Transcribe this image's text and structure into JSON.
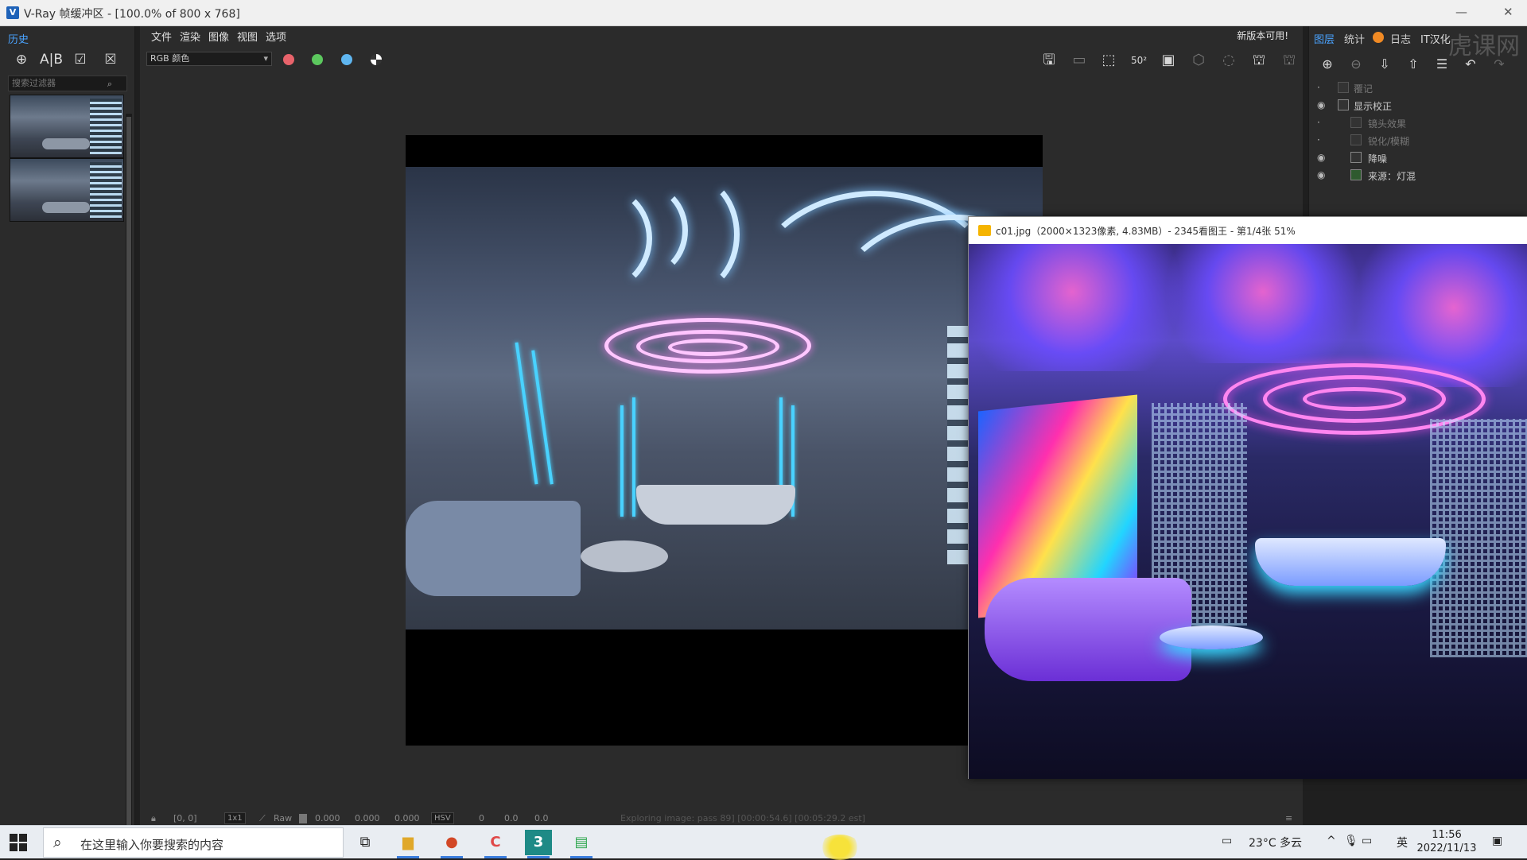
{
  "window": {
    "title": "V-Ray 帧缓冲区 - [100.0% of 800 x 768]"
  },
  "history": {
    "tab": "历史",
    "search_placeholder": "搜索过滤器",
    "thumb_count": 2
  },
  "menu": {
    "items": [
      "文件",
      "渲染",
      "图像",
      "视图",
      "选项"
    ],
    "notice": "新版本可用!"
  },
  "toolbar": {
    "channel": "RGB 颜色",
    "colors": {
      "red": "#e8636b",
      "green": "#5cc85e",
      "blue": "#5fb6f0"
    }
  },
  "right_panel": {
    "tabs": [
      "图层",
      "统计",
      "日志"
    ],
    "watermark": "虎课网",
    "badge": "IT汉化",
    "layers": [
      {
        "label": "覆记",
        "visible": false,
        "dim": true,
        "indent": 0
      },
      {
        "label": "显示校正",
        "visible": true,
        "dim": false,
        "indent": 0
      },
      {
        "label": "镜头效果",
        "visible": false,
        "dim": true,
        "indent": 1
      },
      {
        "label": "锐化/模糊",
        "visible": false,
        "dim": true,
        "indent": 1
      },
      {
        "label": "降噪",
        "visible": true,
        "dim": false,
        "indent": 1
      },
      {
        "label": "来源：灯混",
        "visible": true,
        "dim": false,
        "indent": 1
      }
    ]
  },
  "status": {
    "coords": "[0, 0]",
    "zoom_sel": "1x1",
    "mode": "Raw",
    "r": "0.000",
    "g": "0.000",
    "b": "0.000",
    "color_space": "HSV",
    "h": "0",
    "s": "0.0",
    "v": "0.0",
    "progress_text": "Exploring image: pass 89] [00:00:54.6] [00:05:29.2 est]"
  },
  "viewer": {
    "title": "c01.jpg（2000×1323像素, 4.83MB）- 2345看图王 - 第1/4张 51%"
  },
  "taskbar": {
    "search_placeholder": "在这里输入你要搜索的内容",
    "weather": "23°C 多云",
    "ime": "英",
    "time": "11:56",
    "date": "2022/11/13"
  }
}
